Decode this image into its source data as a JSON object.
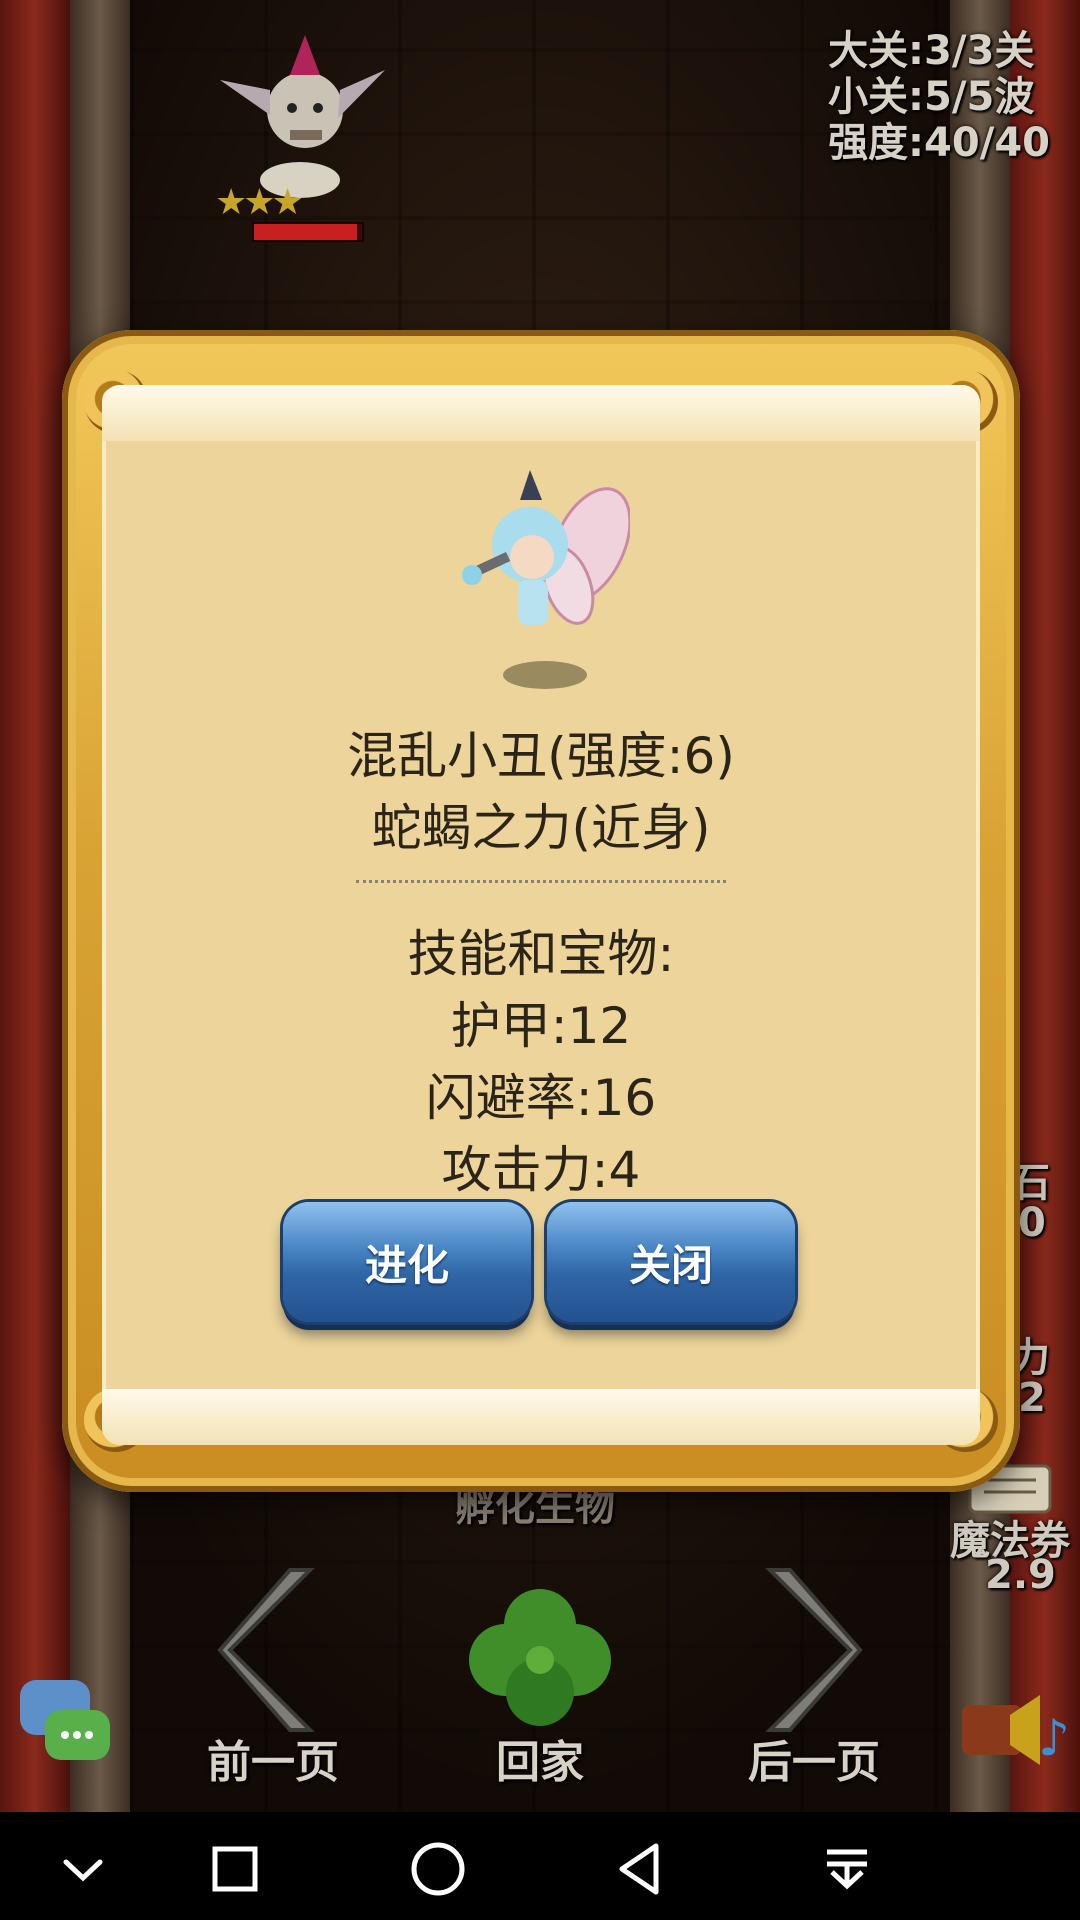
{
  "stage_info": {
    "big_level": "大关:3/3关",
    "small_level": "小关:5/5波",
    "strength": "强度:40/40"
  },
  "enemy": {
    "stars": "★★★",
    "hp_fraction": 0.95
  },
  "background_labels": {
    "faded_under_dialog": "孵化生物",
    "right_side_1": "石",
    "right_side_1b": "0",
    "right_side_2": "力",
    "right_side_2b": "2",
    "magic_ticket_label": "魔法券",
    "magic_ticket_value": "2.9"
  },
  "bottom_nav": {
    "prev_label": "前一页",
    "home_label": "回家",
    "next_label": "后一页"
  },
  "dialog": {
    "unit_name": "混乱小丑(强度:6)",
    "unit_type": "蛇蝎之力(近身)",
    "skills_title": "技能和宝物:",
    "stats": [
      "护甲:12",
      "闪避率:16",
      "攻击力:4"
    ],
    "evolve_button": "进化",
    "close_button": "关闭"
  },
  "colors": {
    "button_blue": "#2f66a6",
    "paper": "#ecd49a",
    "frame_gold": "#d9a334"
  },
  "icons": {
    "system_nav": [
      "chevron-down-icon",
      "square-recents-icon",
      "circle-home-icon",
      "triangle-back-icon",
      "pull-down-icon"
    ]
  }
}
